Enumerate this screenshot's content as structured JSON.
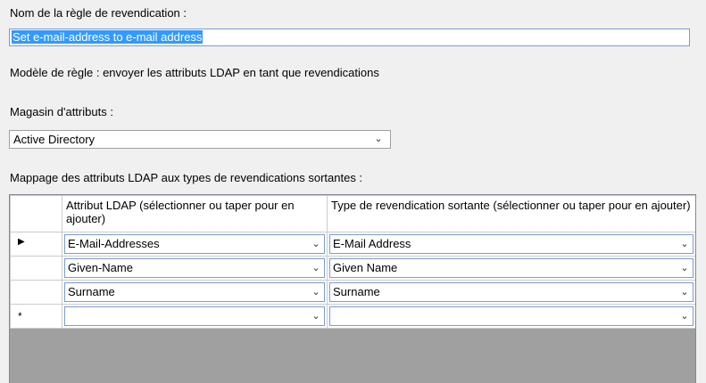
{
  "rule_name": {
    "label": "Nom de la règle de revendication :",
    "value": "Set e-mail-address to e-mail address"
  },
  "template_text": "Modèle de règle : envoyer les attributs LDAP en tant que revendications",
  "attribute_store": {
    "label": "Magasin d'attributs :",
    "selected": "Active Directory"
  },
  "mapping": {
    "label": "Mappage des attributs LDAP aux types de revendications sortantes :",
    "columns": [
      "Attribut LDAP (sélectionner ou taper pour en ajouter)",
      "Type de revendication sortante (sélectionner ou taper pour en ajouter)"
    ],
    "rows": [
      {
        "marker": "▶",
        "ldap": "E-Mail-Addresses",
        "claim": "E-Mail Address"
      },
      {
        "marker": "",
        "ldap": "Given-Name",
        "claim": "Given Name"
      },
      {
        "marker": "",
        "ldap": "Surname",
        "claim": "Surname"
      },
      {
        "marker": "*",
        "ldap": "",
        "claim": ""
      }
    ]
  },
  "icons": {
    "dropdown": "chevron-down-icon",
    "current_row": "row-pointer-icon",
    "new_row": "new-row-asterisk-icon"
  }
}
